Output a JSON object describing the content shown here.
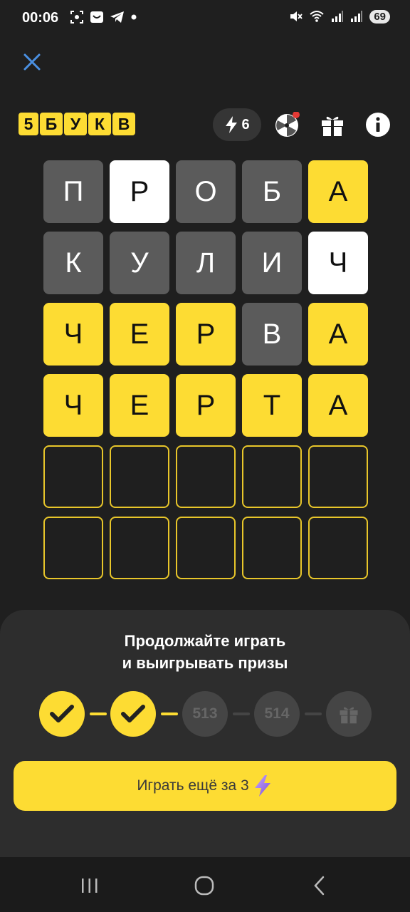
{
  "status_bar": {
    "time": "00:06",
    "battery": "69",
    "icons_left": [
      "screenshot-icon",
      "smile-app-icon",
      "telegram-icon",
      "dot-icon"
    ],
    "icons_right": [
      "mute-icon",
      "wifi-icon",
      "signal-icon",
      "signal-icon"
    ]
  },
  "header": {
    "logo_letters": [
      "5",
      "Б",
      "У",
      "К",
      "В"
    ],
    "energy_count": "6"
  },
  "grid": [
    [
      {
        "l": "П",
        "s": "gray"
      },
      {
        "l": "Р",
        "s": "white"
      },
      {
        "l": "О",
        "s": "gray"
      },
      {
        "l": "Б",
        "s": "gray"
      },
      {
        "l": "А",
        "s": "yellow"
      }
    ],
    [
      {
        "l": "К",
        "s": "gray"
      },
      {
        "l": "У",
        "s": "gray"
      },
      {
        "l": "Л",
        "s": "gray"
      },
      {
        "l": "И",
        "s": "gray"
      },
      {
        "l": "Ч",
        "s": "white"
      }
    ],
    [
      {
        "l": "Ч",
        "s": "yellow"
      },
      {
        "l": "Е",
        "s": "yellow"
      },
      {
        "l": "Р",
        "s": "yellow"
      },
      {
        "l": "В",
        "s": "gray"
      },
      {
        "l": "А",
        "s": "yellow"
      }
    ],
    [
      {
        "l": "Ч",
        "s": "yellow"
      },
      {
        "l": "Е",
        "s": "yellow"
      },
      {
        "l": "Р",
        "s": "yellow"
      },
      {
        "l": "Т",
        "s": "yellow"
      },
      {
        "l": "А",
        "s": "yellow"
      }
    ],
    [
      {
        "l": "",
        "s": "empty"
      },
      {
        "l": "",
        "s": "empty"
      },
      {
        "l": "",
        "s": "empty"
      },
      {
        "l": "",
        "s": "empty"
      },
      {
        "l": "",
        "s": "empty"
      }
    ],
    [
      {
        "l": "",
        "s": "empty"
      },
      {
        "l": "",
        "s": "empty"
      },
      {
        "l": "",
        "s": "empty"
      },
      {
        "l": "",
        "s": "empty"
      },
      {
        "l": "",
        "s": "empty"
      }
    ]
  ],
  "sheet": {
    "title_line1": "Продолжайте играть",
    "title_line2": "и выигрывать призы",
    "steps": [
      {
        "label": "",
        "state": "done"
      },
      {
        "label": "",
        "state": "done"
      },
      {
        "label": "513",
        "state": "todo"
      },
      {
        "label": "514",
        "state": "todo"
      },
      {
        "label": "",
        "state": "gift"
      }
    ],
    "play_button_label": "Играть ещё за 3"
  },
  "colors": {
    "accent": "#fddc33",
    "absent": "#5b5b5b",
    "present": "#ffffff",
    "background": "#1f1f1f"
  }
}
